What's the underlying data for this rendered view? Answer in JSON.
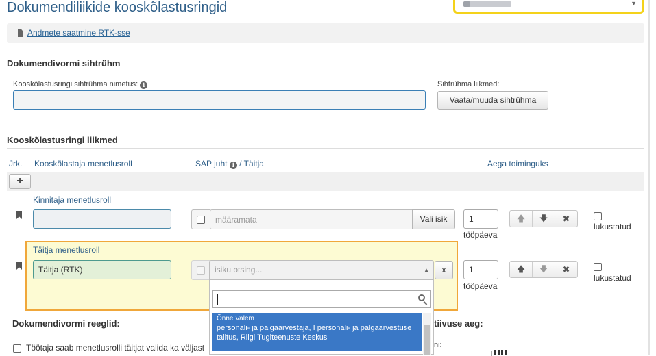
{
  "page": {
    "title": "Dokumendiliikide kooskõlastusringid",
    "export_link": "Andmete saatmine RTK-sse"
  },
  "target_group": {
    "section_title": "Dokumendivormi sihtrühm",
    "name_label": "Kooskõlastusringi sihtrühma nimetus:",
    "name_value": "",
    "members_label": "Sihtrühma liikmed:",
    "view_button": "Vaata/muuda sihtrühma"
  },
  "members": {
    "section_title": "Kooskõlastusringi liikmed",
    "columns": {
      "order": "Jrk.",
      "role": "Kooskõlastaja menetlusroll",
      "sap_prefix": "SAP juht",
      "sap_suffix": "/ Täitja",
      "deadline": "Aega toiminguks"
    },
    "add_button": "+",
    "rows": [
      {
        "role_label": "Kinnitaja menetlusroll",
        "role_value": "",
        "person_value": "määramata",
        "choose_button": "Vali isik",
        "days": "1",
        "days_unit": "tööpäeva",
        "up": "🡅",
        "down": "🡇",
        "remove": "✖",
        "locked_label": "lukustatud"
      },
      {
        "role_label": "Täitja menetlusroll",
        "role_value": "Täitja (RTK)",
        "person_placeholder": "isiku otsing...",
        "clear_button": "x",
        "days": "1",
        "days_unit": "tööpäeva",
        "up": "🡅",
        "down": "🡇",
        "remove": "✖",
        "locked_label": "lukustatud"
      }
    ]
  },
  "dropdown": {
    "search_value": "",
    "option_name": "Õnne Valem",
    "option_desc": "personali- ja palgaarvestaja, I personali- ja palgaarvestuse talitus, Riigi Tugiteenuste Keskus"
  },
  "rules": {
    "section_title": "Dokumendivormi reeglid:",
    "checkbox_text": "Töötaja saab menetlusrolli täitjat valida ka väljast",
    "right_title_partial": "tiivuse aeg:",
    "right_label_partial": "ni:"
  },
  "colors": {
    "title_blue": "#2f5f89",
    "highlight_border": "#f0a73a",
    "highlight_bg": "#fdfbd3",
    "selected_option": "#3a78c6",
    "selector_border": "#f4d21a"
  }
}
